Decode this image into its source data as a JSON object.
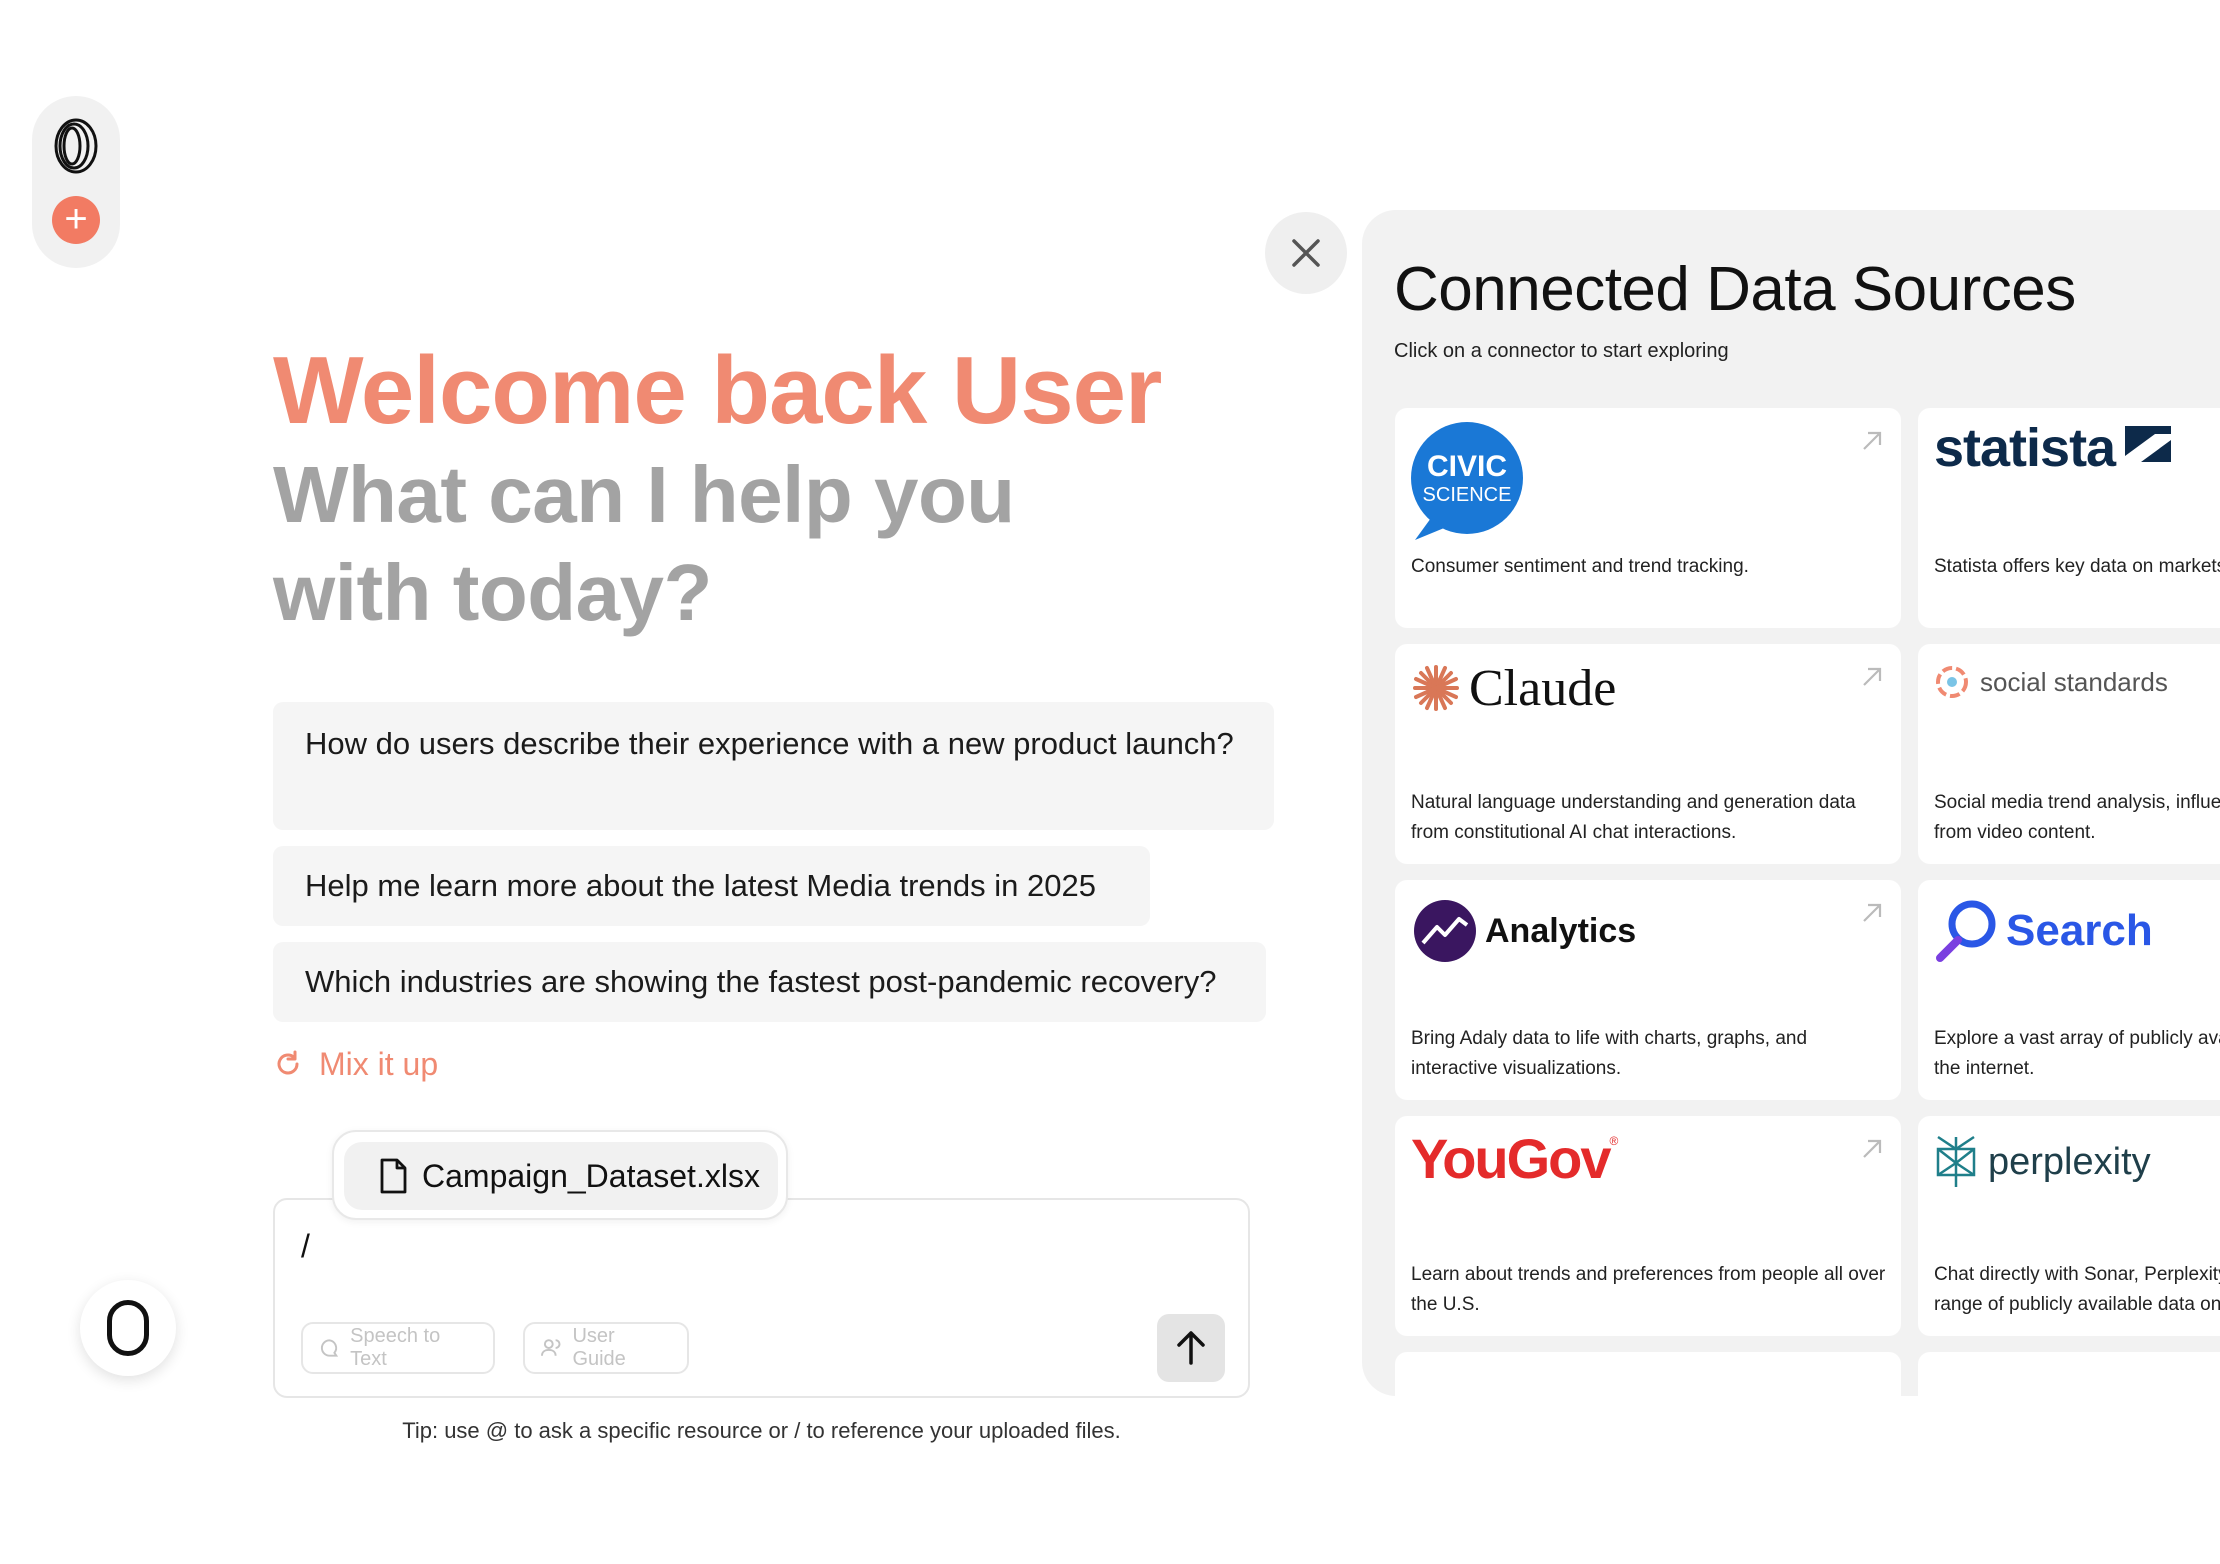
{
  "greeting": {
    "title": "Welcome back User",
    "subtitle": "What can I help you with today?"
  },
  "suggestions": [
    "How do users describe their experience with a new product launch?",
    "Help me learn more about the latest Media trends in 2025",
    "Which industries are showing the fastest post-pandemic recovery?"
  ],
  "mix_label": "Mix it up",
  "attachment": {
    "filename": "Campaign_Dataset.xlsx"
  },
  "composer": {
    "value": "/",
    "speech_label": "Speech to Text",
    "guide_label": "User Guide"
  },
  "tip": "Tip: use @ to ask a specific resource or / to reference your uploaded files.",
  "panel": {
    "title": "Connected Data Sources",
    "subtitle": "Click on a connector to start exploring",
    "connectors": [
      {
        "logo_text_1": "CIVIC",
        "logo_text_2": "SCIENCE",
        "description": "Consumer sentiment and trend tracking."
      },
      {
        "logo_text": "statista",
        "description": "Statista offers key data on markets and consumers."
      },
      {
        "logo_text": "Claude",
        "description": "Natural language understanding and generation data from constitutional AI chat interactions."
      },
      {
        "logo_text": "social standards",
        "description": "Social media trend analysis, influencer and brand affinity from video content."
      },
      {
        "logo_text": "Analytics",
        "description": "Bring Adaly data to life with charts, graphs, and interactive visualizations."
      },
      {
        "logo_text": "Search",
        "description": "Explore a vast array of publicly available data from across the internet."
      },
      {
        "logo_text": "YouGov",
        "description": "Learn about trends and preferences from people all over the U.S."
      },
      {
        "logo_text": "perplexity",
        "description": "Chat directly with Sonar, Perplexity's AI, to explore a wide range of publicly available data online."
      }
    ]
  },
  "colors": {
    "accent": "#f08a72",
    "subtitle_gray": "#a3a3a3",
    "civic_blue": "#1a78d6",
    "search_blue": "#2a57e6",
    "yougov_red": "#e42b2b"
  }
}
